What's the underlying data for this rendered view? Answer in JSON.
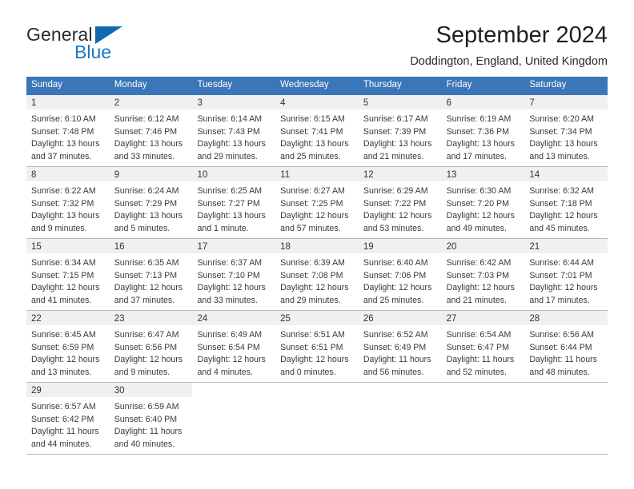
{
  "brand": {
    "name_part1": "General",
    "name_part2": "Blue",
    "triangle_color": "#1269b0",
    "blue_text_color": "#1878c4"
  },
  "header": {
    "month_title": "September 2024",
    "location": "Doddington, England, United Kingdom"
  },
  "theme": {
    "header_blue": "#3a76b8",
    "day_number_band": "#f0f0f0",
    "row_divider": "#b9b9b9"
  },
  "weekdays": [
    "Sunday",
    "Monday",
    "Tuesday",
    "Wednesday",
    "Thursday",
    "Friday",
    "Saturday"
  ],
  "weeks": [
    [
      {
        "day": "1",
        "sunrise": "Sunrise: 6:10 AM",
        "sunset": "Sunset: 7:48 PM",
        "daylight_line1": "Daylight: 13 hours",
        "daylight_line2": "and 37 minutes."
      },
      {
        "day": "2",
        "sunrise": "Sunrise: 6:12 AM",
        "sunset": "Sunset: 7:46 PM",
        "daylight_line1": "Daylight: 13 hours",
        "daylight_line2": "and 33 minutes."
      },
      {
        "day": "3",
        "sunrise": "Sunrise: 6:14 AM",
        "sunset": "Sunset: 7:43 PM",
        "daylight_line1": "Daylight: 13 hours",
        "daylight_line2": "and 29 minutes."
      },
      {
        "day": "4",
        "sunrise": "Sunrise: 6:15 AM",
        "sunset": "Sunset: 7:41 PM",
        "daylight_line1": "Daylight: 13 hours",
        "daylight_line2": "and 25 minutes."
      },
      {
        "day": "5",
        "sunrise": "Sunrise: 6:17 AM",
        "sunset": "Sunset: 7:39 PM",
        "daylight_line1": "Daylight: 13 hours",
        "daylight_line2": "and 21 minutes."
      },
      {
        "day": "6",
        "sunrise": "Sunrise: 6:19 AM",
        "sunset": "Sunset: 7:36 PM",
        "daylight_line1": "Daylight: 13 hours",
        "daylight_line2": "and 17 minutes."
      },
      {
        "day": "7",
        "sunrise": "Sunrise: 6:20 AM",
        "sunset": "Sunset: 7:34 PM",
        "daylight_line1": "Daylight: 13 hours",
        "daylight_line2": "and 13 minutes."
      }
    ],
    [
      {
        "day": "8",
        "sunrise": "Sunrise: 6:22 AM",
        "sunset": "Sunset: 7:32 PM",
        "daylight_line1": "Daylight: 13 hours",
        "daylight_line2": "and 9 minutes."
      },
      {
        "day": "9",
        "sunrise": "Sunrise: 6:24 AM",
        "sunset": "Sunset: 7:29 PM",
        "daylight_line1": "Daylight: 13 hours",
        "daylight_line2": "and 5 minutes."
      },
      {
        "day": "10",
        "sunrise": "Sunrise: 6:25 AM",
        "sunset": "Sunset: 7:27 PM",
        "daylight_line1": "Daylight: 13 hours",
        "daylight_line2": "and 1 minute."
      },
      {
        "day": "11",
        "sunrise": "Sunrise: 6:27 AM",
        "sunset": "Sunset: 7:25 PM",
        "daylight_line1": "Daylight: 12 hours",
        "daylight_line2": "and 57 minutes."
      },
      {
        "day": "12",
        "sunrise": "Sunrise: 6:29 AM",
        "sunset": "Sunset: 7:22 PM",
        "daylight_line1": "Daylight: 12 hours",
        "daylight_line2": "and 53 minutes."
      },
      {
        "day": "13",
        "sunrise": "Sunrise: 6:30 AM",
        "sunset": "Sunset: 7:20 PM",
        "daylight_line1": "Daylight: 12 hours",
        "daylight_line2": "and 49 minutes."
      },
      {
        "day": "14",
        "sunrise": "Sunrise: 6:32 AM",
        "sunset": "Sunset: 7:18 PM",
        "daylight_line1": "Daylight: 12 hours",
        "daylight_line2": "and 45 minutes."
      }
    ],
    [
      {
        "day": "15",
        "sunrise": "Sunrise: 6:34 AM",
        "sunset": "Sunset: 7:15 PM",
        "daylight_line1": "Daylight: 12 hours",
        "daylight_line2": "and 41 minutes."
      },
      {
        "day": "16",
        "sunrise": "Sunrise: 6:35 AM",
        "sunset": "Sunset: 7:13 PM",
        "daylight_line1": "Daylight: 12 hours",
        "daylight_line2": "and 37 minutes."
      },
      {
        "day": "17",
        "sunrise": "Sunrise: 6:37 AM",
        "sunset": "Sunset: 7:10 PM",
        "daylight_line1": "Daylight: 12 hours",
        "daylight_line2": "and 33 minutes."
      },
      {
        "day": "18",
        "sunrise": "Sunrise: 6:39 AM",
        "sunset": "Sunset: 7:08 PM",
        "daylight_line1": "Daylight: 12 hours",
        "daylight_line2": "and 29 minutes."
      },
      {
        "day": "19",
        "sunrise": "Sunrise: 6:40 AM",
        "sunset": "Sunset: 7:06 PM",
        "daylight_line1": "Daylight: 12 hours",
        "daylight_line2": "and 25 minutes."
      },
      {
        "day": "20",
        "sunrise": "Sunrise: 6:42 AM",
        "sunset": "Sunset: 7:03 PM",
        "daylight_line1": "Daylight: 12 hours",
        "daylight_line2": "and 21 minutes."
      },
      {
        "day": "21",
        "sunrise": "Sunrise: 6:44 AM",
        "sunset": "Sunset: 7:01 PM",
        "daylight_line1": "Daylight: 12 hours",
        "daylight_line2": "and 17 minutes."
      }
    ],
    [
      {
        "day": "22",
        "sunrise": "Sunrise: 6:45 AM",
        "sunset": "Sunset: 6:59 PM",
        "daylight_line1": "Daylight: 12 hours",
        "daylight_line2": "and 13 minutes."
      },
      {
        "day": "23",
        "sunrise": "Sunrise: 6:47 AM",
        "sunset": "Sunset: 6:56 PM",
        "daylight_line1": "Daylight: 12 hours",
        "daylight_line2": "and 9 minutes."
      },
      {
        "day": "24",
        "sunrise": "Sunrise: 6:49 AM",
        "sunset": "Sunset: 6:54 PM",
        "daylight_line1": "Daylight: 12 hours",
        "daylight_line2": "and 4 minutes."
      },
      {
        "day": "25",
        "sunrise": "Sunrise: 6:51 AM",
        "sunset": "Sunset: 6:51 PM",
        "daylight_line1": "Daylight: 12 hours",
        "daylight_line2": "and 0 minutes."
      },
      {
        "day": "26",
        "sunrise": "Sunrise: 6:52 AM",
        "sunset": "Sunset: 6:49 PM",
        "daylight_line1": "Daylight: 11 hours",
        "daylight_line2": "and 56 minutes."
      },
      {
        "day": "27",
        "sunrise": "Sunrise: 6:54 AM",
        "sunset": "Sunset: 6:47 PM",
        "daylight_line1": "Daylight: 11 hours",
        "daylight_line2": "and 52 minutes."
      },
      {
        "day": "28",
        "sunrise": "Sunrise: 6:56 AM",
        "sunset": "Sunset: 6:44 PM",
        "daylight_line1": "Daylight: 11 hours",
        "daylight_line2": "and 48 minutes."
      }
    ],
    [
      {
        "day": "29",
        "sunrise": "Sunrise: 6:57 AM",
        "sunset": "Sunset: 6:42 PM",
        "daylight_line1": "Daylight: 11 hours",
        "daylight_line2": "and 44 minutes."
      },
      {
        "day": "30",
        "sunrise": "Sunrise: 6:59 AM",
        "sunset": "Sunset: 6:40 PM",
        "daylight_line1": "Daylight: 11 hours",
        "daylight_line2": "and 40 minutes."
      },
      {
        "day": "",
        "sunrise": "",
        "sunset": "",
        "daylight_line1": "",
        "daylight_line2": ""
      },
      {
        "day": "",
        "sunrise": "",
        "sunset": "",
        "daylight_line1": "",
        "daylight_line2": ""
      },
      {
        "day": "",
        "sunrise": "",
        "sunset": "",
        "daylight_line1": "",
        "daylight_line2": ""
      },
      {
        "day": "",
        "sunrise": "",
        "sunset": "",
        "daylight_line1": "",
        "daylight_line2": ""
      },
      {
        "day": "",
        "sunrise": "",
        "sunset": "",
        "daylight_line1": "",
        "daylight_line2": ""
      }
    ]
  ]
}
